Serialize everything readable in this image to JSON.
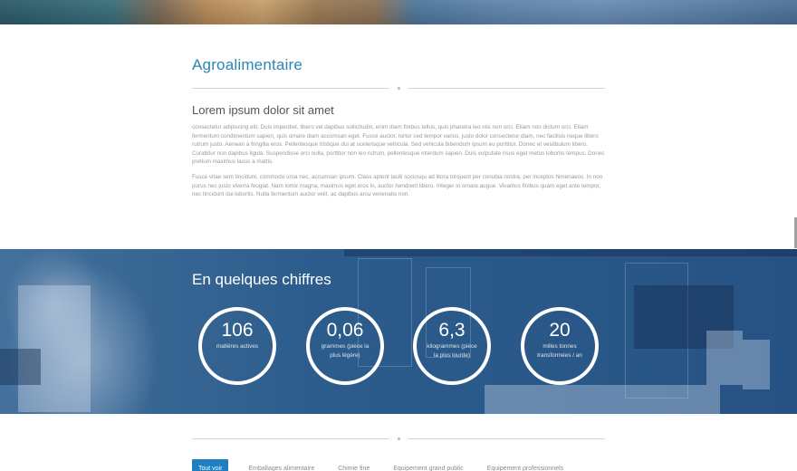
{
  "intro": {
    "title": "Agroalimentaire",
    "subtitle": "Lorem ipsum dolor sit amet",
    "paragraph_1": "consectetur adipiscing elit. Duis imperdiet, libero vel dapibus sollicitudin, enim diam finibus tellus, quis pharetra leo nisi non orci. Etiam non dictum orci. Etiam fermentum condimentum sapien, quis ornare diam accumsan eget. Fusce auctor, tortor sed tempor varius, justo dolor consectetur diam, nec facilisis neque libero rutrum justo. Aenean a fringilla eros. Pellentesque tristique dui at scelerisque vehicula. Sed vehicula bibendum ipsum eu porttitor. Donec et vestibulum libero. Curabitur non dapibus ligula. Suspendisse orci nulla, porttitor non leo rutrum, pellentesque interdum sapien. Duis vulputate risus eget metus lobortis tempus. Donec pretium maximus lacus a mattis.",
    "paragraph_2": "Fusce vitae sem tincidunt, commodo urna nec, accumsan ipsum. Class aptent taciti sociosqu ad litora torquent per conubia nostra, per inceptos himenaeos. In non purus nec justo viverra feugiat. Nam tortor magna, maximus eget eros in, auctor hendrerit libero. Integer in ornare augue. Vivamus finibus quam eget ante tempor, nec tincidunt dui lobortis. Nulla fermentum auctor velit, ac dapibus arcu venenatis non."
  },
  "figures": {
    "title": "En quelques chiffres",
    "stats": [
      {
        "value": "106",
        "label": "matières actives"
      },
      {
        "value": "0,06",
        "label": "grammes (pièce la plus légère)"
      },
      {
        "value": "6,3",
        "label": "kilogrammes (pièce la plus lourde)"
      },
      {
        "value": "20",
        "label": "milles tonnes transformées / an"
      }
    ]
  },
  "filters": [
    {
      "label": "Tout voir",
      "active": true
    },
    {
      "label": "Emballages alimentaire",
      "active": false
    },
    {
      "label": "Chimie fine",
      "active": false
    },
    {
      "label": "Equipement grand public",
      "active": false
    },
    {
      "label": "Equipement professionnels",
      "active": false
    }
  ],
  "colors": {
    "accent": "#2a86b5",
    "filter_active": "#1f7fc1",
    "band_overlay": "#2d5e8e"
  }
}
